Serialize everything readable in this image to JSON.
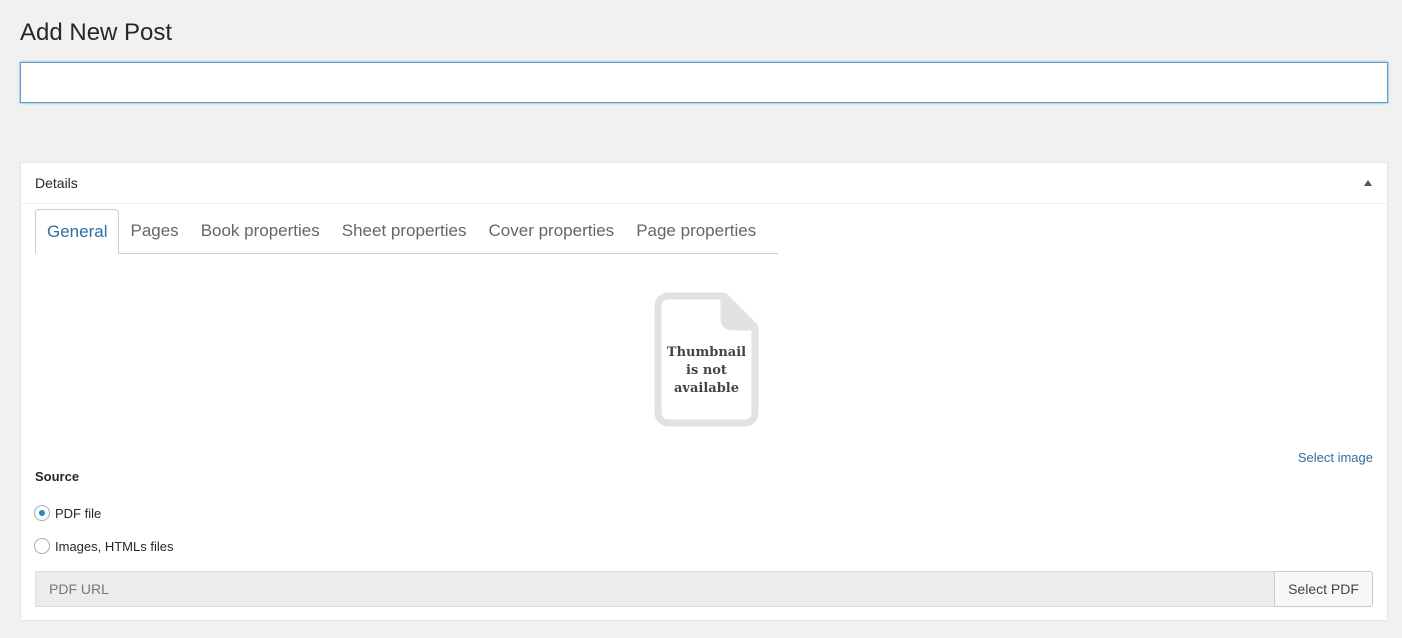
{
  "header": {
    "page_title": "Add New Post",
    "title_input_value": ""
  },
  "details_box": {
    "title": "Details",
    "tabs": [
      {
        "label": "General",
        "active": true
      },
      {
        "label": "Pages",
        "active": false
      },
      {
        "label": "Book properties",
        "active": false
      },
      {
        "label": "Sheet properties",
        "active": false
      },
      {
        "label": "Cover properties",
        "active": false
      },
      {
        "label": "Page properties",
        "active": false
      }
    ],
    "thumbnail": {
      "icon": "document-placeholder-icon",
      "line1": "Thumbnail",
      "line2": "is not",
      "line3": "available"
    },
    "select_image_label": "Select image",
    "source": {
      "label": "Source",
      "options": [
        {
          "label": "PDF file",
          "checked": true
        },
        {
          "label": "Images, HTMLs files",
          "checked": false
        }
      ]
    },
    "pdf_url_placeholder": "PDF URL",
    "select_pdf_label": "Select PDF"
  },
  "colors": {
    "background": "#f1f1f1",
    "link": "#2f6fa2",
    "radio_checked": "#1e8cbe",
    "input_focus_border": "#5b9dd9"
  }
}
